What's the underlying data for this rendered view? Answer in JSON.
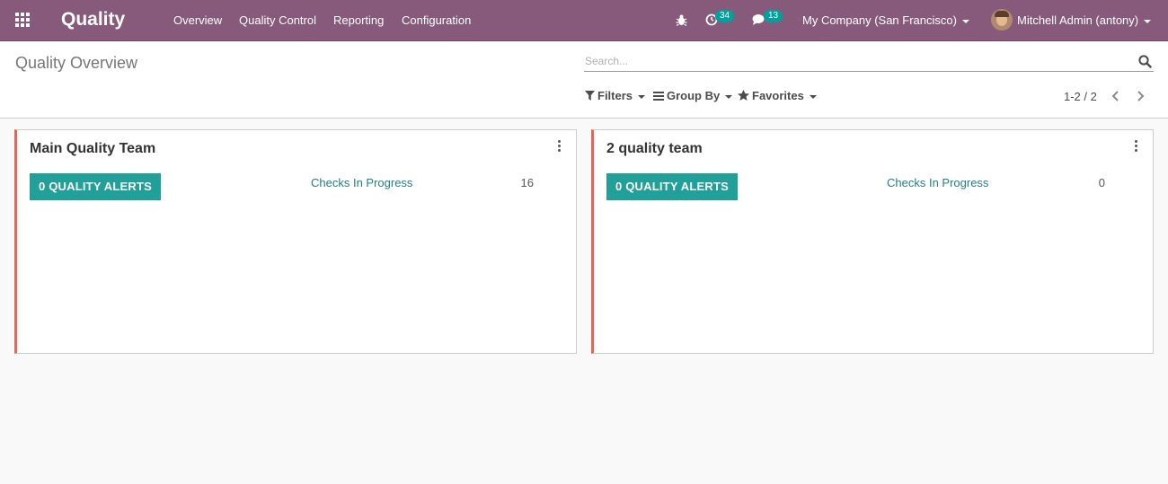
{
  "navbar": {
    "app_title": "Quality",
    "menu": [
      "Overview",
      "Quality Control",
      "Reporting",
      "Configuration"
    ],
    "activity_count": "34",
    "message_count": "13",
    "company": "My Company (San Francisco)",
    "user": "Mitchell Admin (antony)",
    "background_color": "#875a7b",
    "badge_color": "#00a09d"
  },
  "control_panel": {
    "title": "Quality Overview",
    "search_placeholder": "Search...",
    "filters_label": "Filters",
    "groupby_label": "Group By",
    "favorites_label": "Favorites",
    "pager_value": "1-2 / 2"
  },
  "kanban": {
    "accent_color": "#e2675b",
    "button_color": "#21a09a",
    "cards": [
      {
        "title": "Main Quality Team",
        "alerts_button": "0 QUALITY ALERTS",
        "checks_label": "Checks In Progress",
        "checks_count": "16"
      },
      {
        "title": "2 quality team",
        "alerts_button": "0 QUALITY ALERTS",
        "checks_label": "Checks In Progress",
        "checks_count": "0"
      }
    ]
  }
}
